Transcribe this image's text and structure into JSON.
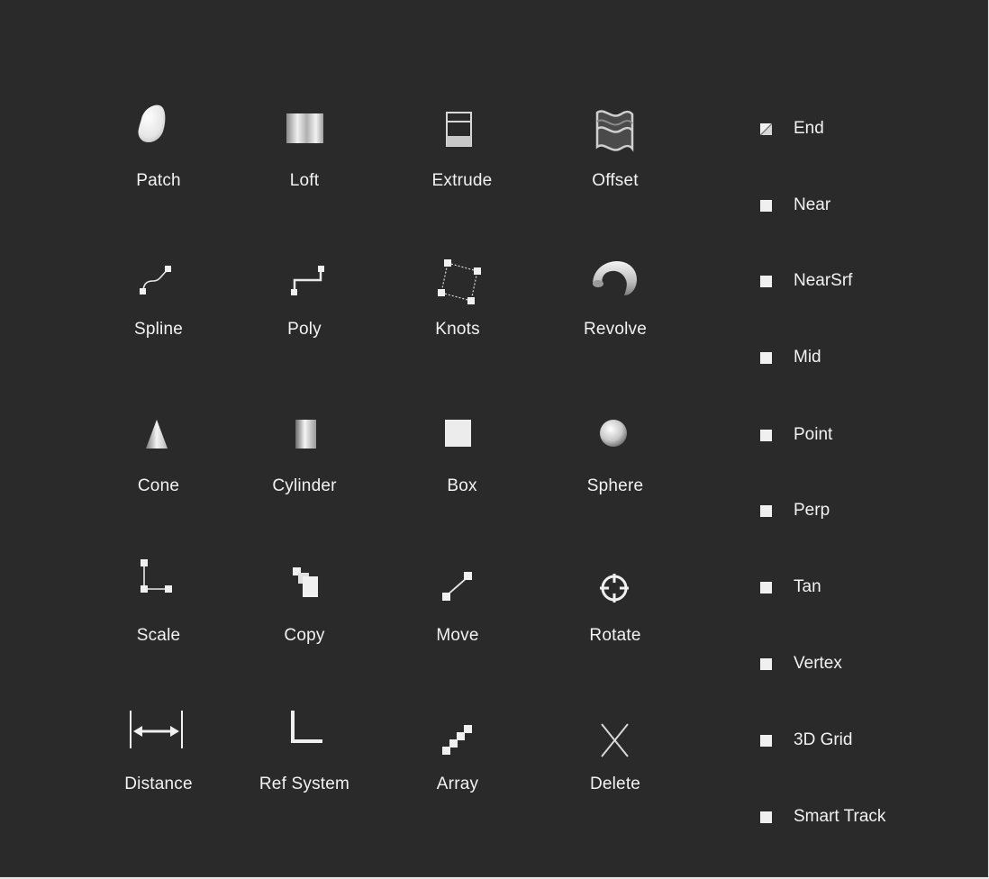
{
  "tools": {
    "patch": "Patch",
    "loft": "Loft",
    "extrude": "Extrude",
    "offset": "Offset",
    "spline": "Spline",
    "poly": "Poly",
    "knots": "Knots",
    "revolve": "Revolve",
    "cone": "Cone",
    "cylinder": "Cylinder",
    "box": "Box",
    "sphere": "Sphere",
    "scale": "Scale",
    "copy": "Copy",
    "move": "Move",
    "rotate": "Rotate",
    "distance": "Distance",
    "ref_system": "Ref System",
    "array": "Array",
    "delete": "Delete"
  },
  "snaps": {
    "end": "End",
    "near": "Near",
    "nearsrf": "NearSrf",
    "mid": "Mid",
    "point": "Point",
    "perp": "Perp",
    "tan": "Tan",
    "vertex": "Vertex",
    "grid3d": "3D Grid",
    "smart_track": "Smart Track"
  },
  "colors": {
    "background": "#2a2a2a",
    "foreground": "#f2f2f2"
  }
}
